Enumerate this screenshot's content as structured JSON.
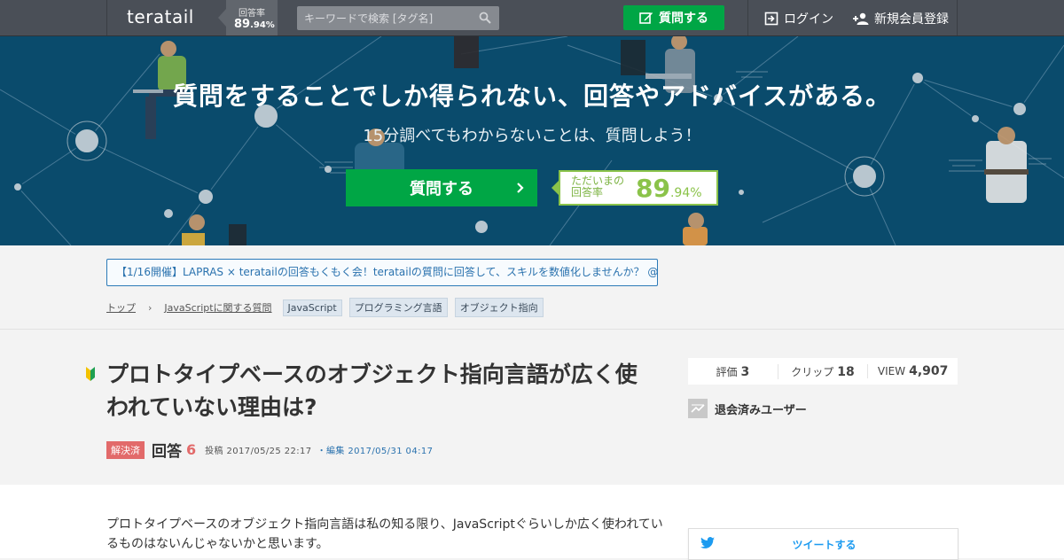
{
  "nav": {
    "logo": "teratail",
    "rate_label": "回答率",
    "rate_int": "89",
    "rate_dec": ".94%",
    "search_placeholder": "キーワードで検索 [タグ名]",
    "ask_label": "質問する",
    "login_label": "ログイン",
    "signup_label": "新規会員登録"
  },
  "hero": {
    "title": "質問をすることでしか得られない、回答やアドバイスがある。",
    "subtitle": "15分調べてもわからないことは、質問しよう！",
    "ask_label": "質問する",
    "rate_label_line1": "ただいまの",
    "rate_label_line2": "回答率",
    "rate_int": "89",
    "rate_dec": ".94%"
  },
  "notice": {
    "text": "【1/16開催】LAPRAS × teratailの回答もくもく会！teratailの質問に回答して、スキルを数値化しませんか？ @渋谷"
  },
  "breadcrumb": {
    "top": "トップ",
    "arrow": "›",
    "category": "JavaScriptに関する質問",
    "tags": [
      "JavaScript",
      "プログラミング言語",
      "オブジェクト指向"
    ]
  },
  "question": {
    "title": "プロトタイプベースのオブジェクト指向言語が広く使われていない理由は?",
    "solved_label": "解決済",
    "answers_label": "回答",
    "answers_count": "6",
    "posted": "投稿 2017/05/25 22:17",
    "edited": "・編集 2017/05/31 04:17",
    "body": "プロトタイプベースのオブジェクト指向言語は私の知る限り、JavaScriptぐらいしか広く使われているものはないんじゃないかと思います。"
  },
  "stats": {
    "rating_label": "評価",
    "rating": "3",
    "clip_label": "クリップ",
    "clip": "18",
    "view_label": "VIEW",
    "views": "4,907"
  },
  "user": {
    "name": "退会済みユーザー"
  },
  "share": {
    "tweet_label": "ツイートする"
  },
  "colors": {
    "nav_bg": "#4a4f57",
    "hero_bg": "#0a4b6c",
    "green": "#00a645",
    "rate_green": "#8bc34a",
    "solved_red": "#e26a6a",
    "link_blue": "#2a72ae",
    "twitter_blue": "#1d9bf0"
  }
}
